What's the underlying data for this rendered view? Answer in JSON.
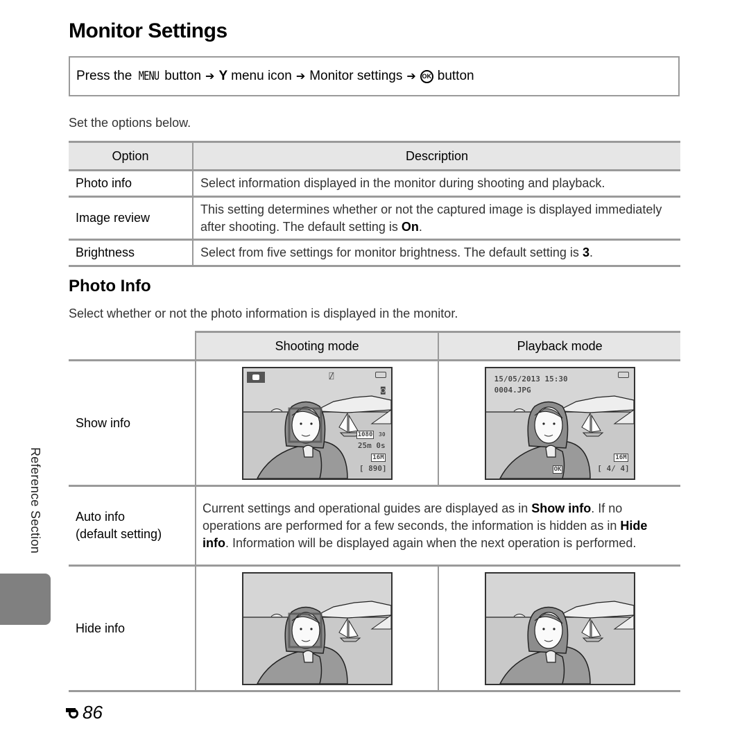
{
  "page": {
    "title": "Monitor Settings",
    "procedure": {
      "press_the": "Press the",
      "menu_button_glyph": "MENU",
      "button": "button",
      "arrow": "➔",
      "wrench_glyph": "Y",
      "menu_icon": "menu icon",
      "monitor_settings": "Monitor settings",
      "ok_glyph": "OK",
      "button_end": "button"
    },
    "lead": "Set the options below.",
    "options_table": {
      "headers": [
        "Option",
        "Description"
      ],
      "rows": [
        {
          "option": "Photo info",
          "desc": "Select information displayed in the monitor during shooting and playback.",
          "bold": ""
        },
        {
          "option": "Image review",
          "desc": "This setting determines whether or not the captured image is displayed immediately after shooting. The default setting is ",
          "bold": "On",
          "end": "."
        },
        {
          "option": "Brightness",
          "desc": "Select from five settings for monitor brightness. The default setting is ",
          "bold": "3",
          "end": "."
        }
      ]
    },
    "section_title": "Photo Info",
    "section_lead": "Select whether or not the photo information is displayed in the monitor.",
    "photo_info_table": {
      "headers": [
        "",
        "Shooting mode",
        "Playback mode"
      ],
      "rows": {
        "show_info": {
          "label": "Show info"
        },
        "auto_info": {
          "label_line1": "Auto info",
          "label_line2": "(default setting)",
          "text_a": "Current settings and operational guides are displayed as in ",
          "bold_a": "Show info",
          "text_b": ". If no operations are performed for a few seconds, the information is hidden as in ",
          "bold_b": "Hide info",
          "text_c": ". Information will be displayed again when the next operation is performed."
        },
        "hide_info": {
          "label": "Hide info"
        }
      }
    },
    "shooting_overlay": {
      "movie_res": "1080",
      "fps": "30",
      "time_remaining": "25m 0s",
      "image_size": "16M",
      "exposures_remaining": "[ 890]"
    },
    "playback_overlay": {
      "datetime": "15/05/2013  15:30",
      "filename": "0004.JPG",
      "image_size": "16M",
      "ok_guide": "OK",
      "frame_counter": "[   4/   4]"
    },
    "side_tab": "Reference Section",
    "page_number": "86",
    "page_prefix_icon": "e-reference-icon"
  }
}
